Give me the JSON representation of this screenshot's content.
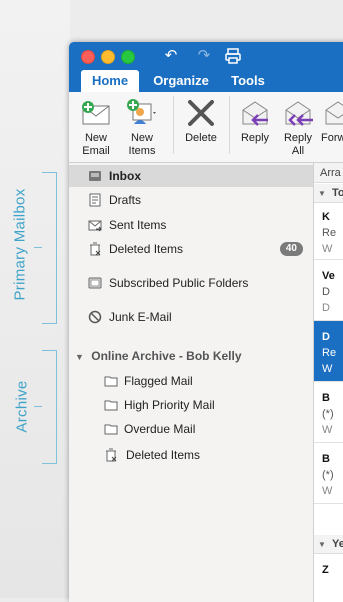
{
  "annotations": {
    "primary": "Primary Mailbox",
    "archive": "Archive"
  },
  "titlebar": {
    "undo_icon": "undo-icon",
    "redo_icon": "redo-icon",
    "print_icon": "print-icon"
  },
  "tabs": [
    {
      "label": "Home"
    },
    {
      "label": "Organize"
    },
    {
      "label": "Tools"
    }
  ],
  "ribbon": {
    "new_email": "New\nEmail",
    "new_items": "New\nItems",
    "delete": "Delete",
    "reply": "Reply",
    "reply_all": "Reply\nAll",
    "forward": "Forw"
  },
  "sidebar": {
    "items": [
      {
        "label": "Inbox"
      },
      {
        "label": "Drafts"
      },
      {
        "label": "Sent Items"
      },
      {
        "label": "Deleted Items",
        "badge": "40"
      },
      {
        "label": "Subscribed Public Folders"
      },
      {
        "label": "Junk E-Mail"
      }
    ],
    "archive_header": "Online Archive - Bob Kelly",
    "archive_items": [
      {
        "label": "Flagged Mail"
      },
      {
        "label": "High Priority Mail"
      },
      {
        "label": "Overdue Mail"
      },
      {
        "label": "Deleted Items"
      }
    ]
  },
  "messages": {
    "arrange": "Arra",
    "group_today": "To",
    "group_yesterday": "Ye",
    "rows": [
      {
        "a": "K",
        "b": "Re",
        "c": "W"
      },
      {
        "a": "Ve",
        "b": "D",
        "c": "D"
      },
      {
        "a": "D",
        "b": "Re",
        "c": "W"
      },
      {
        "a": "B",
        "b": "(*)",
        "c": "W"
      },
      {
        "a": "B",
        "b": "(*)",
        "c": "W"
      },
      {
        "a": "Z",
        "b": "",
        "c": ""
      }
    ]
  },
  "colors": {
    "accent": "#1a6fc2",
    "annotation": "#3fa3c9",
    "badge": "#7a7a7a"
  }
}
